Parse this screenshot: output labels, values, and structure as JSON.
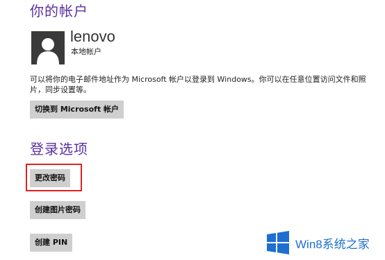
{
  "account": {
    "section_title": "你的帐户",
    "user_name": "lenovo",
    "account_type": "本地帐户",
    "description": "可以将你的电子邮件地址作为 Microsoft 帐户以登录到 Windows。你可以在任意位置访问文件和照片，同步设置等。",
    "switch_button_label": "切换到 Microsoft 帐户"
  },
  "signin": {
    "section_title": "登录选项",
    "change_password_label": "更改密码",
    "picture_password_label": "创建图片密码",
    "create_pin_label": "创建 PIN"
  },
  "highlight": {
    "color": "#e02020"
  },
  "watermark": {
    "text": "Win8系统之家",
    "icon": "windows-logo-icon",
    "color": "#1e6fd0"
  },
  "colors": {
    "accent": "#5b2fa0",
    "button_bg": "#cfcfcf",
    "avatar_bg": "#3a3a3a"
  }
}
